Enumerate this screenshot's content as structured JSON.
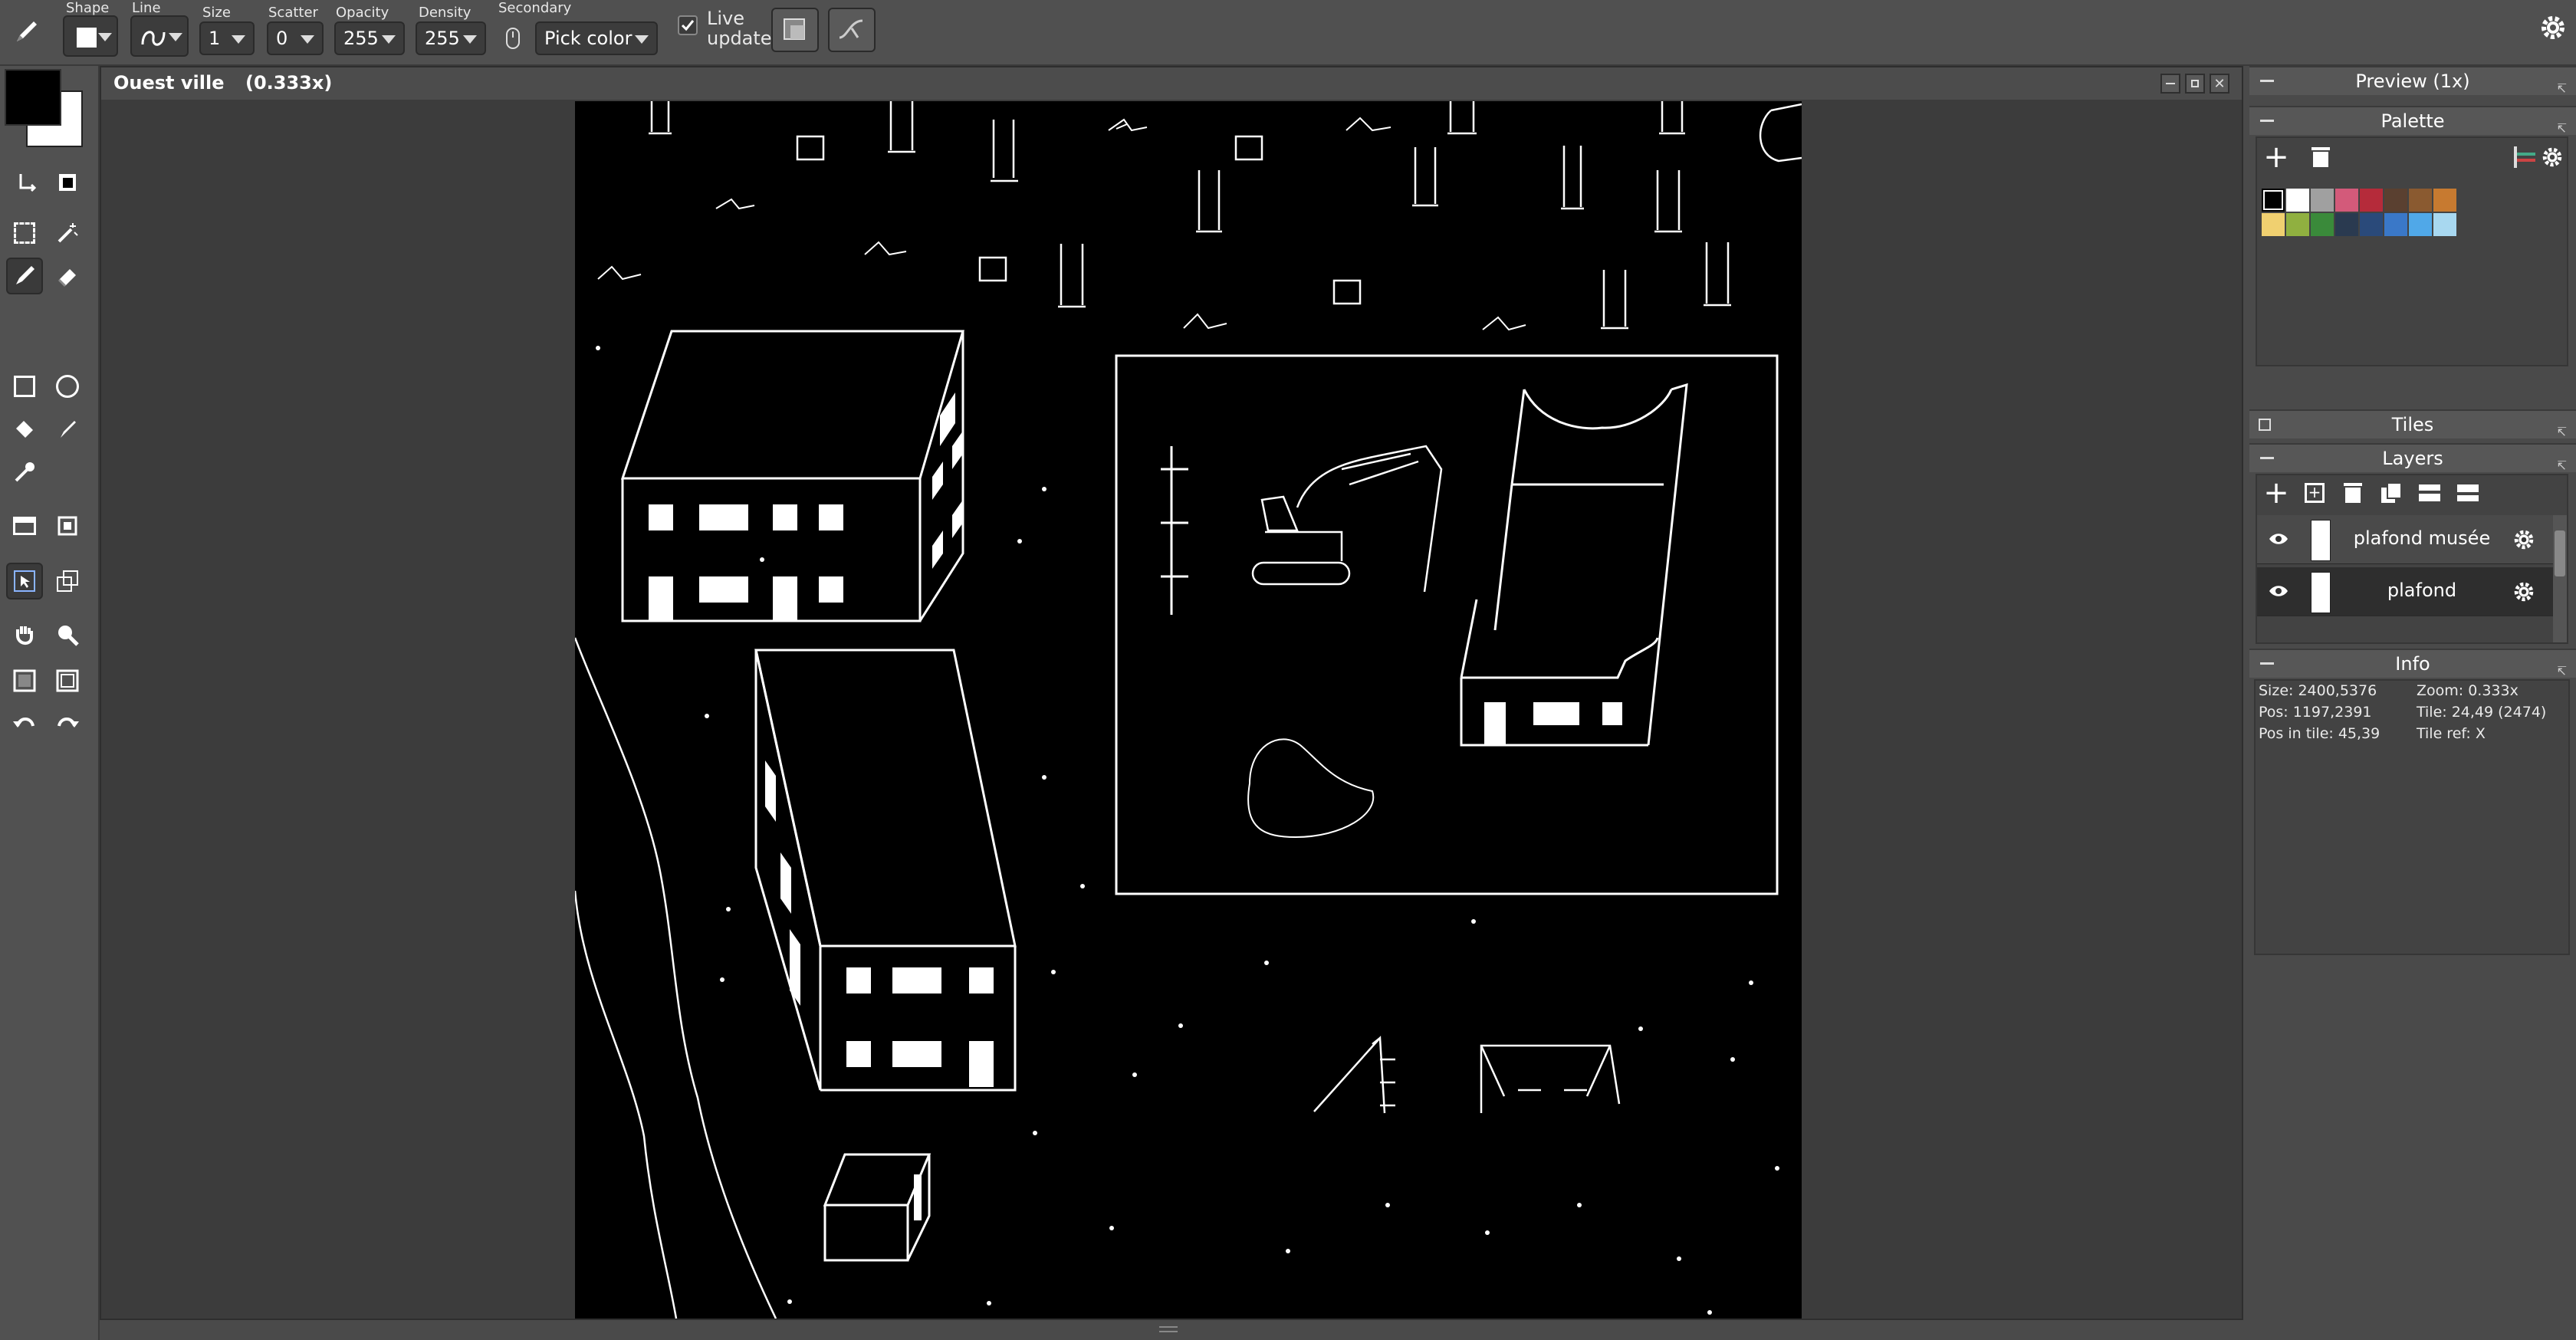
{
  "toolbar": {
    "shape_label": "Shape",
    "line_label": "Line",
    "size_label": "Size",
    "size_value": "1",
    "scatter_label": "Scatter",
    "scatter_value": "0",
    "opacity_label": "Opacity",
    "opacity_value": "255",
    "density_label": "Density",
    "density_value": "255",
    "secondary_label": "Secondary",
    "secondary_value": "Pick color",
    "live_update_line1": "Live",
    "live_update_line2": "update",
    "live_update_checked": true
  },
  "document": {
    "title": "Ouest ville",
    "zoom": "(0.333x)"
  },
  "panels": {
    "preview": {
      "title": "Preview (1x)"
    },
    "palette": {
      "title": "Palette",
      "colors_row1": [
        "#000000",
        "#ffffff",
        "#a0a0a0",
        "#d35a7a",
        "#b52b3a",
        "#5a4030",
        "#8a5a30",
        "#c77a30"
      ],
      "colors_row2": [
        "#f0d070",
        "#90b040",
        "#3a8a3a",
        "#2a3a50",
        "#2a4a7a",
        "#3a78c8",
        "#50a8e8",
        "#a8d8f0"
      ]
    },
    "tiles": {
      "title": "Tiles"
    },
    "layers": {
      "title": "Layers",
      "items": [
        {
          "name": "plafond musée"
        },
        {
          "name": "plafond"
        }
      ]
    },
    "info": {
      "title": "Info",
      "size": "Size: 2400,5376",
      "zoom": "Zoom: 0.333x",
      "pos": "Pos: 1197,2391",
      "tile": "Tile: 24,49 (2474)",
      "pos_in_tile": "Pos in tile: 45,39",
      "tile_ref": "Tile ref: X"
    }
  }
}
